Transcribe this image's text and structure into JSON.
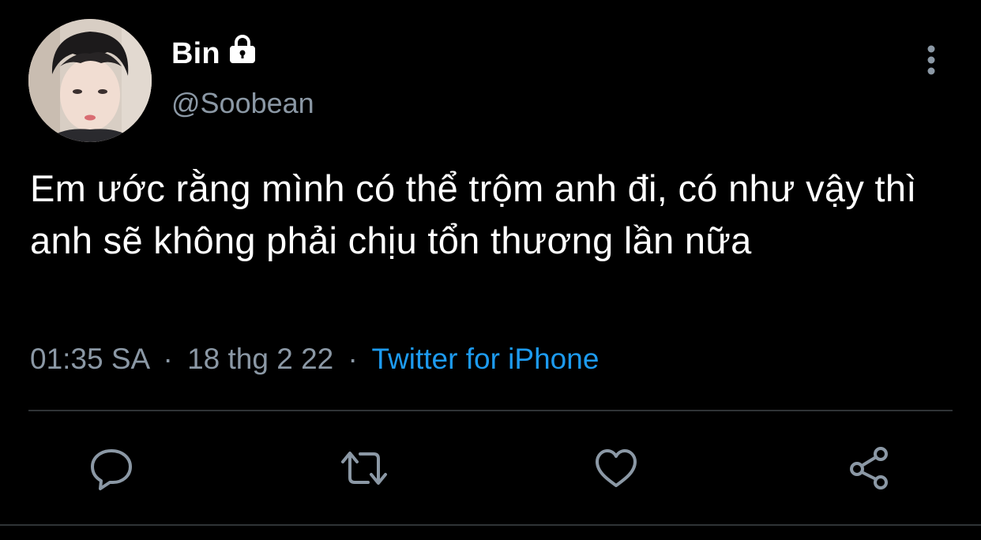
{
  "tweet": {
    "display_name": "Bin",
    "handle": "@Soobean",
    "text": "Em ước rằng mình có thể trộm anh đi, có như vậy thì anh sẽ không phải chịu tổn thương lần nữa",
    "time": "01:35 SA",
    "date": "18 thg 2 22",
    "separator": "·",
    "source": "Twitter for iPhone",
    "protected": true
  },
  "icons": {
    "lock": "lock-icon",
    "more": "more-vertical-icon",
    "reply": "reply-icon",
    "retweet": "retweet-icon",
    "like": "like-icon",
    "share": "share-icon"
  },
  "colors": {
    "background": "#000000",
    "text_primary": "#ffffff",
    "text_secondary": "#8b98a5",
    "accent": "#1d9bf0",
    "divider": "#2f3336"
  }
}
